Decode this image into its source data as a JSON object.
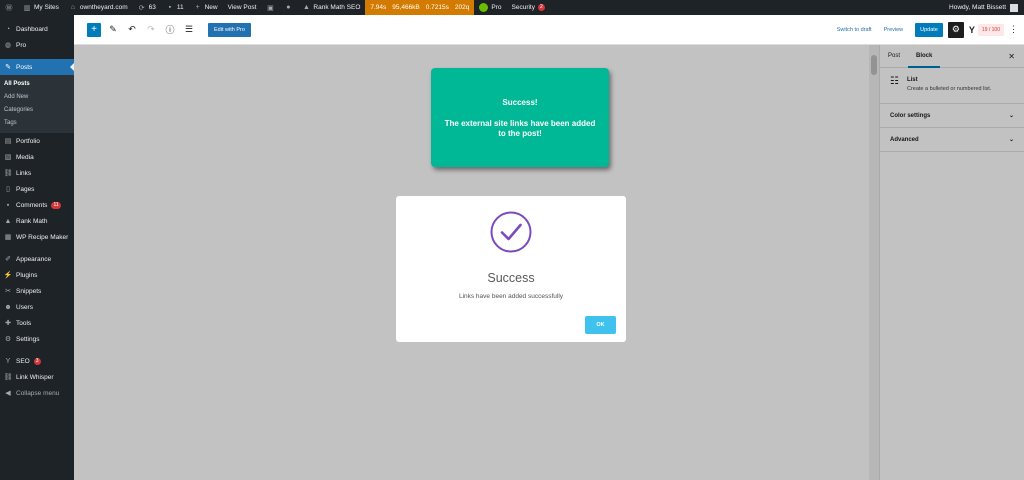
{
  "adminbar": {
    "my_sites": "My Sites",
    "site_name": "owntheyard.com",
    "updates_count": "63",
    "comments_count": "11",
    "new_label": "New",
    "view_post": "View Post",
    "rank_math": "Rank Math SEO",
    "perf": [
      "7.94s",
      "95,466kB",
      "0.7215s",
      "202q"
    ],
    "pro": "Pro",
    "security": "Security",
    "security_count": "2",
    "howdy": "Howdy, Matt Bissett"
  },
  "sidebar": {
    "items": [
      {
        "label": "Dashboard",
        "icon": "dashboard-icon"
      },
      {
        "label": "Pro",
        "icon": "pro-icon"
      },
      {
        "label": "Posts",
        "icon": "pin-icon"
      },
      {
        "label": "Portfolio",
        "icon": "portfolio-icon"
      },
      {
        "label": "Media",
        "icon": "media-icon"
      },
      {
        "label": "Links",
        "icon": "links-icon"
      },
      {
        "label": "Pages",
        "icon": "pages-icon"
      },
      {
        "label": "Comments",
        "icon": "comments-icon",
        "badge": "11"
      },
      {
        "label": "Rank Math",
        "icon": "rankmath-icon"
      },
      {
        "label": "WP Recipe Maker",
        "icon": "recipe-icon"
      },
      {
        "label": "Appearance",
        "icon": "appearance-icon"
      },
      {
        "label": "Plugins",
        "icon": "plugins-icon"
      },
      {
        "label": "Snippets",
        "icon": "snippets-icon"
      },
      {
        "label": "Users",
        "icon": "users-icon"
      },
      {
        "label": "Tools",
        "icon": "tools-icon"
      },
      {
        "label": "Settings",
        "icon": "settings-icon"
      },
      {
        "label": "SEO",
        "icon": "seo-icon",
        "badge": "3"
      },
      {
        "label": "Link Whisper",
        "icon": "linkwhisper-icon"
      },
      {
        "label": "Collapse menu",
        "icon": "collapse-icon"
      }
    ],
    "posts_submenu": [
      "All Posts",
      "Add New",
      "Categories",
      "Tags"
    ]
  },
  "editor": {
    "edit_with_pro": "Edit with Pro",
    "switch_to_draft": "Switch to draft",
    "preview": "Preview",
    "update": "Update",
    "rm_score": "19 / 100"
  },
  "settings": {
    "tab_post": "Post",
    "tab_block": "Block",
    "block_name": "List",
    "block_desc": "Create a bulleted or numbered list.",
    "color_settings": "Color settings",
    "advanced": "Advanced"
  },
  "toast": {
    "title": "Success!",
    "message": "The external site links have been added to the post!"
  },
  "modal": {
    "title": "Success",
    "text": "Links have been added successfully",
    "ok": "OK"
  },
  "colors": {
    "toast_bg": "#00b895",
    "check_stroke": "#7a4bbd",
    "ok_button": "#3fc3ee",
    "admin_accent": "#2271b1",
    "perf_bar": "#d27b00"
  }
}
